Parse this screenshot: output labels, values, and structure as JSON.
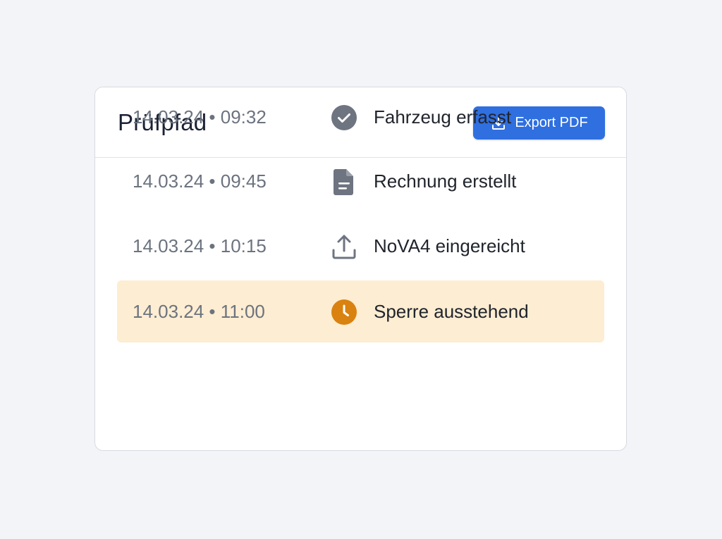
{
  "card": {
    "title": "Prüfpfad",
    "export_label": "Export PDF"
  },
  "entries": [
    {
      "time": "14.03.24 • 09:32",
      "label": "Fahrzeug erfasst",
      "icon": "check-circle-icon"
    },
    {
      "time": "14.03.24 • 09:45",
      "label": "Rechnung erstellt",
      "icon": "document-icon"
    },
    {
      "time": "14.03.24 • 10:15",
      "label": "NoVA4 eingereicht",
      "icon": "upload-icon"
    },
    {
      "time": "14.03.24 • 11:00",
      "label": "Sperre ausstehend",
      "icon": "clock-icon",
      "status": "pending"
    }
  ],
  "colors": {
    "accent": "#2f6fe0",
    "pending_background": "#fdedd2",
    "pending_icon": "#d9820f",
    "neutral_icon": "#6e7480"
  }
}
